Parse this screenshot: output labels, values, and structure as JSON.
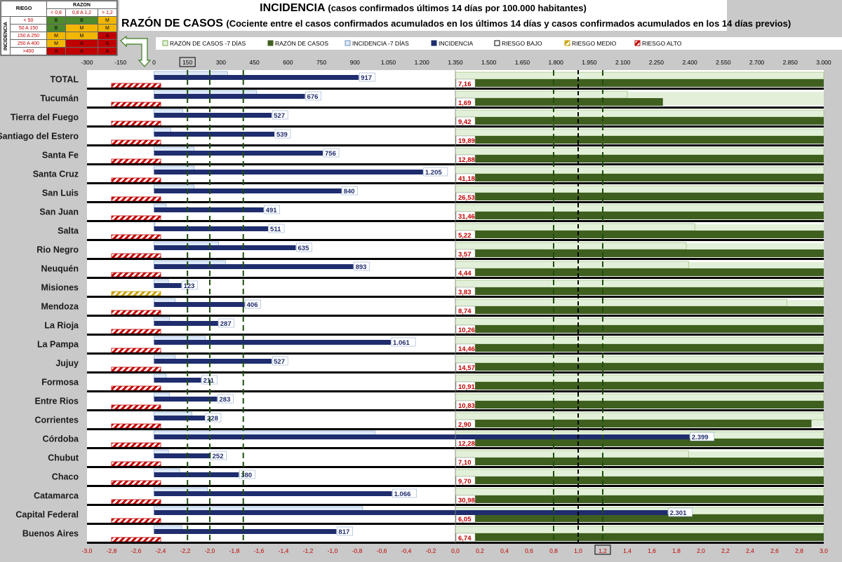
{
  "title_main": "INCIDENCIA",
  "title_main_sub": "(casos confirmados últimos 14 días por 100.000 habitantes)",
  "title_ratio": "RAZÓN DE CASOS",
  "title_ratio_sub": "(Cociente entre el casos confirmados acumulados en los últimos 14 días y casos confirmados acumulados en los 14 días previos)",
  "risk_table": {
    "riego_label": "RIEGO",
    "razon_label": "RAZON",
    "incidencia_label": "INCIDENCIA",
    "ratio_cols": [
      "< 0,8",
      "0,8 A 1,2",
      "> 1,2"
    ],
    "rows": [
      {
        "range": "< 50",
        "cells": [
          "B",
          "B",
          "M"
        ]
      },
      {
        "range": "50 A 150",
        "cells": [
          "B",
          "M",
          "M"
        ]
      },
      {
        "range": "150 A 250",
        "cells": [
          "M",
          "M",
          "A"
        ]
      },
      {
        "range": "250 A 400",
        "cells": [
          "M",
          "A",
          "A"
        ]
      },
      {
        "range": ">400",
        "cells": [
          "A",
          "A",
          "A"
        ]
      }
    ]
  },
  "colors": {
    "incidence": "#1f2d6e",
    "incidence_prev": "#dde9f7",
    "ratio": "#3f5f1f",
    "ratio_prev": "#e2f0d9",
    "risk_high": "#c00000",
    "risk_medium": "#c9a000",
    "axis_text": "#c00000"
  },
  "chart_data": {
    "type": "bar",
    "legend": [
      "RAZÓN DE CASOS -7 DÍAS",
      "RAZÓN DE CASOS",
      "INCIDENCIA -7 DÍAS",
      "INCIDENCIA",
      "RIESGO BAJO",
      "RIESGO MEDIO",
      "RIESGO ALTO"
    ],
    "legend_position": "top",
    "top_axis_ticks": [
      "-300",
      "-150",
      "0",
      "150",
      "300",
      "450",
      "600",
      "750",
      "900",
      "1.050",
      "1.200",
      "1.350",
      "1.500",
      "1.650",
      "1.800",
      "1.950",
      "2.100",
      "2.250",
      "2.400",
      "2.550",
      "2.700",
      "2.850",
      "3.000"
    ],
    "bottom_axis_ticks": [
      "-3,0",
      "-2,8",
      "-2,6",
      "-2,4",
      "-2,2",
      "-2,0",
      "-1,8",
      "-1,6",
      "-1,4",
      "-1,2",
      "-1,0",
      "-0,8",
      "-0,6",
      "-0,4",
      "-0,2",
      "0,0",
      "0,2",
      "0,4",
      "0,6",
      "0,8",
      "1,0",
      "1,2",
      "1,4",
      "1,6",
      "1,8",
      "2,0",
      "2,2",
      "2,4",
      "2,6",
      "2,8",
      "3,0"
    ],
    "highlight_top_tick": "150",
    "highlight_bottom_tick": "1,2",
    "incidence_ylim": [
      -300,
      3000
    ],
    "ratio_xlim": [
      -3,
      3
    ],
    "ratio_display_cap": 3.0,
    "incidence_reference_lines": [
      150,
      250,
      400
    ],
    "ratio_reference_lines": [
      0.8,
      1.0,
      1.2
    ],
    "categories": [
      "TOTAL",
      "Tucumán",
      "Tierra del Fuego",
      "Santiago del Estero",
      "Santa Fe",
      "Santa Cruz",
      "San Luis",
      "San Juan",
      "Salta",
      "Rio Negro",
      "Neuquén",
      "Misiones",
      "Mendoza",
      "La Rioja",
      "La Pampa",
      "Jujuy",
      "Formosa",
      "Entre Rios",
      "Corrientes",
      "Córdoba",
      "Chubut",
      "Chaco",
      "Catamarca",
      "Capital Federal",
      "Buenos Aires"
    ],
    "incidence": [
      917,
      676,
      527,
      539,
      756,
      1205,
      840,
      491,
      511,
      635,
      893,
      123,
      406,
      287,
      1061,
      527,
      211,
      283,
      228,
      2399,
      252,
      380,
      1066,
      2301,
      817
    ],
    "incidence_labels": [
      "917",
      "676",
      "527",
      "539",
      "756",
      "1.205",
      "840",
      "491",
      "511",
      "635",
      "893",
      "123",
      "406",
      "287",
      "1.061",
      "527",
      "211",
      "283",
      "228",
      "2.399",
      "252",
      "380",
      "1.066",
      "2.301",
      "817"
    ],
    "incidence_prev": [
      330,
      460,
      130,
      75,
      180,
      180,
      180,
      55,
      5,
      290,
      320,
      65,
      95,
      70,
      230,
      95,
      55,
      70,
      170,
      990,
      65,
      115,
      240,
      935,
      125
    ],
    "ratio_labels": [
      "7,16",
      "1,69",
      "9,42",
      "19,89",
      "12,88",
      "41,18",
      "26,53",
      "31,46",
      "5,22",
      "3,57",
      "4,44",
      "3,83",
      "8,74",
      "10,26",
      "14,46",
      "14,57",
      "10,91",
      "10,83",
      "2,90",
      "12,28",
      "7,10",
      "9,70",
      "30,98",
      "6,05",
      "6,74"
    ],
    "ratio": [
      7.16,
      1.69,
      9.42,
      19.89,
      12.88,
      41.18,
      26.53,
      31.46,
      5.22,
      3.57,
      4.44,
      3.83,
      8.74,
      10.26,
      14.46,
      14.57,
      10.91,
      10.83,
      2.9,
      12.28,
      7.1,
      9.7,
      30.98,
      6.05,
      6.74
    ],
    "ratio_prev": [
      3,
      1.4,
      3,
      3,
      3,
      3,
      3,
      3,
      1.95,
      1.88,
      1.9,
      3,
      2.7,
      3,
      3,
      3,
      3,
      3,
      3,
      3,
      1.9,
      3,
      3,
      3,
      3
    ],
    "risk": [
      "alto",
      "alto",
      "alto",
      "alto",
      "alto",
      "alto",
      "alto",
      "alto",
      "alto",
      "alto",
      "alto",
      "medio",
      "alto",
      "alto",
      "alto",
      "alto",
      "alto",
      "alto",
      "alto",
      "alto",
      "alto",
      "alto",
      "alto",
      "alto",
      "alto"
    ]
  }
}
